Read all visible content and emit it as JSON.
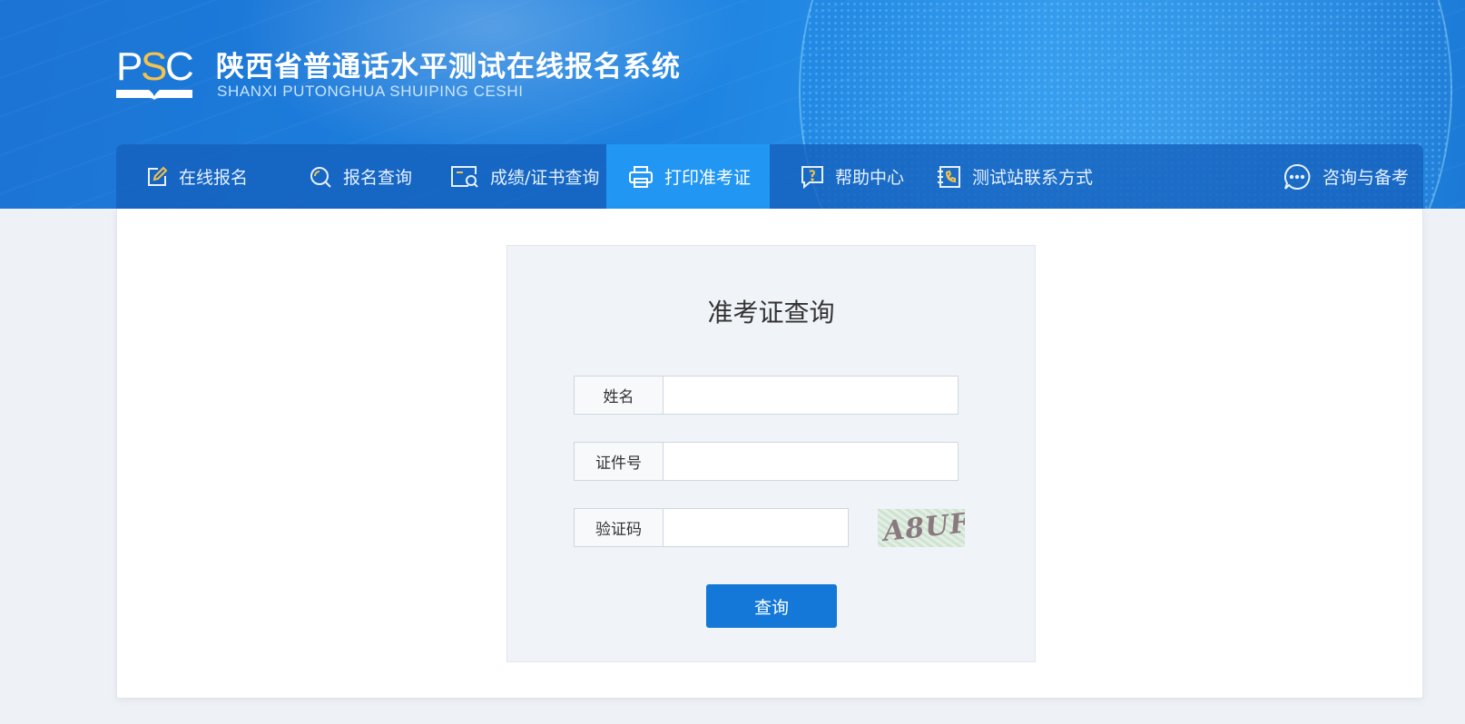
{
  "header": {
    "logo_text": "PSC",
    "title": "陕西省普通话水平测试在线报名系统",
    "subtitle": "SHANXI PUTONGHUA SHUIPING CESHI"
  },
  "nav": {
    "items": [
      {
        "label": "在线报名",
        "icon": "edit-icon"
      },
      {
        "label": "报名查询",
        "icon": "search-circle-icon"
      },
      {
        "label": "成绩/证书查询",
        "icon": "certificate-search-icon"
      },
      {
        "label": "打印准考证",
        "icon": "printer-icon",
        "active": true
      },
      {
        "label": "帮助中心",
        "icon": "help-chat-icon"
      },
      {
        "label": "测试站联系方式",
        "icon": "phone-book-icon"
      },
      {
        "label": "咨询与备考",
        "icon": "chat-bubble-icon"
      }
    ]
  },
  "form": {
    "title": "准考证查询",
    "name_label": "姓名",
    "name_value": "",
    "id_label": "证件号",
    "id_value": "",
    "captcha_label": "验证码",
    "captcha_value": "",
    "captcha_image_text": "A8UF",
    "submit_label": "查询"
  },
  "colors": {
    "primary": "#1478d8",
    "nav_active": "#2196f3",
    "logo_accent": "#f5c24a"
  }
}
